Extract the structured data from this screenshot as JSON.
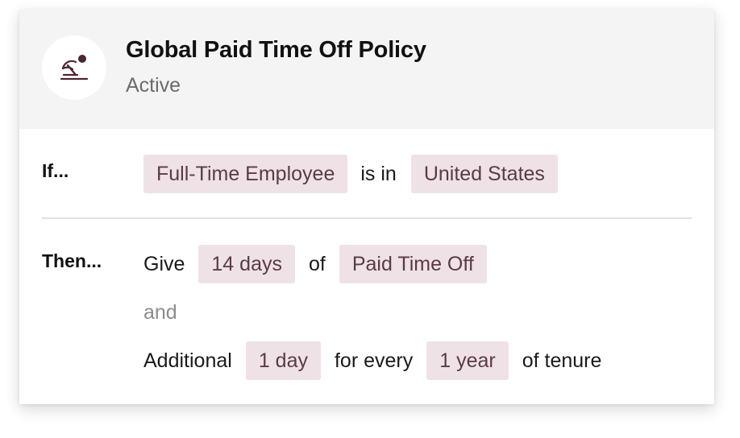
{
  "policy": {
    "icon": "beach-umbrella-icon",
    "title": "Global Paid Time Off Policy",
    "status": "Active"
  },
  "condition": {
    "label": "If...",
    "subject": "Full-Time Employee",
    "operator": "is in",
    "value": "United States"
  },
  "action": {
    "label": "Then...",
    "give_word": "Give",
    "amount": "14 days",
    "of_word": "of",
    "benefit": "Paid Time Off",
    "and_word": "and",
    "additional_word": "Additional",
    "increment": "1 day",
    "for_every_word": "for every",
    "interval": "1 year",
    "tenure_word": "of tenure"
  },
  "colors": {
    "pill_bg": "#efe2e6",
    "pill_text": "#5a3b44",
    "header_bg": "#f4f4f4",
    "icon_color": "#4a2630"
  }
}
